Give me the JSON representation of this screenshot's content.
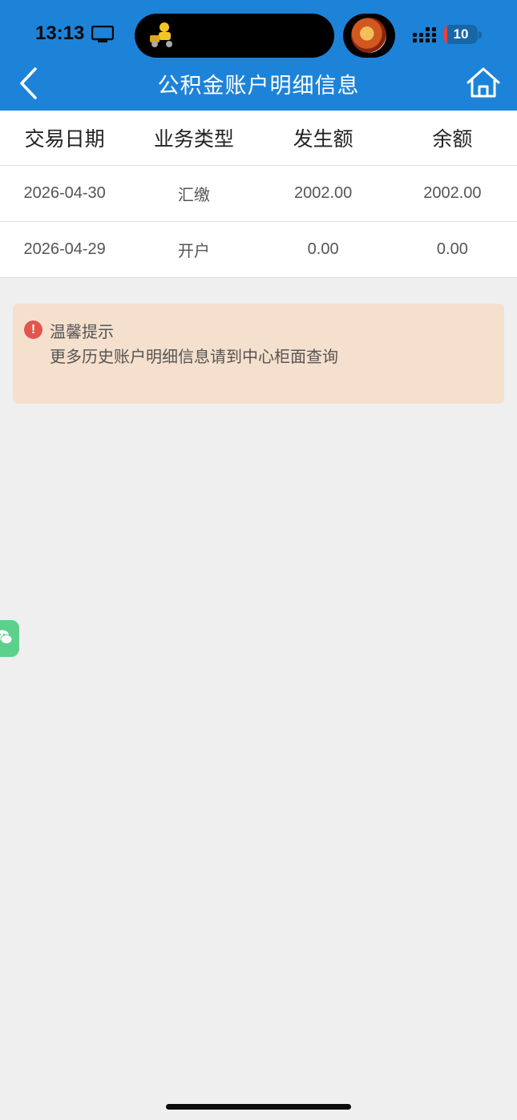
{
  "status_bar": {
    "time": "13:13",
    "battery": "10",
    "battery_level_percent": 10
  },
  "header": {
    "title": "公积金账户明细信息",
    "back_icon": "chevron-left-icon",
    "home_icon": "home-icon"
  },
  "table": {
    "columns": [
      "交易日期",
      "业务类型",
      "发生额",
      "余额"
    ],
    "rows": [
      [
        "2026-04-30",
        "汇缴",
        "2002.00",
        "2002.00"
      ],
      [
        "2026-04-29",
        "开户",
        "0.00",
        "0.00"
      ]
    ]
  },
  "tip": {
    "icon": "exclamation-icon",
    "title": "温馨提示",
    "text": "更多历史账户明细信息请到中心柜面查询"
  },
  "floating_chat": {
    "icon": "wechat-icon"
  },
  "colors": {
    "header": "#1d83d8",
    "background": "#efefef",
    "tip_background": "#f5dfcd",
    "tip_icon": "#e2554e",
    "chat_button": "#5bd18b"
  }
}
